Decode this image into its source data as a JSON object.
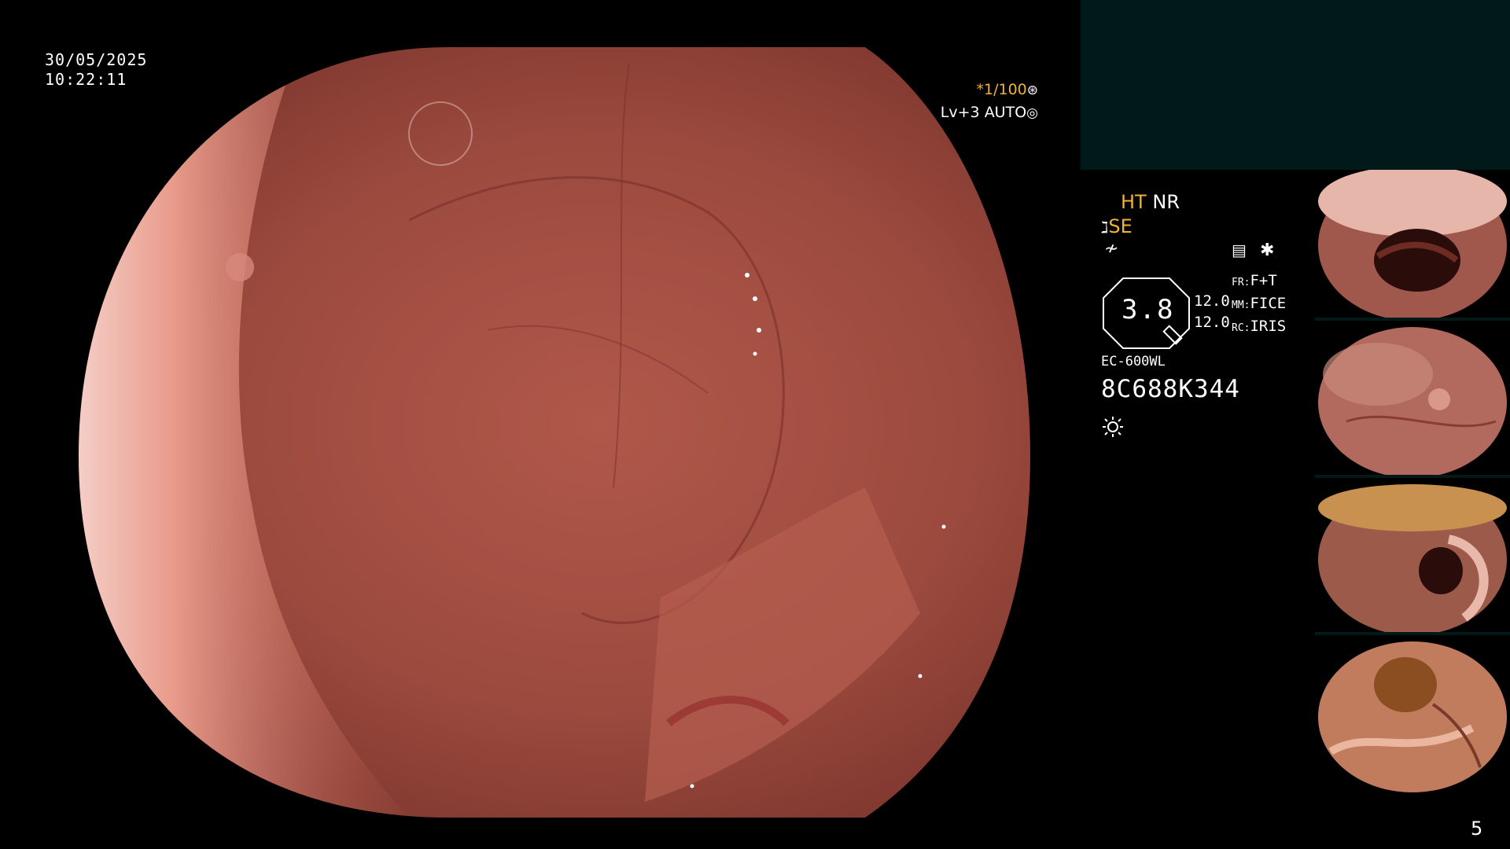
{
  "datetime": {
    "date": "30/05/2025",
    "time": "10:22:11"
  },
  "shutter": {
    "speed": "*1/100",
    "level": "Lv+3",
    "mode": "AUTO"
  },
  "enhancement": {
    "ht": "HT",
    "nr": "NR",
    "se": "SE"
  },
  "zoom": {
    "value": "3.8"
  },
  "settings": {
    "value_a": "12.0",
    "value_b": "12.0",
    "fr_label": "FR:",
    "fr_value": "F+T",
    "mm_label": "MM:",
    "mm_value": "FICE",
    "rc_label": "RC:",
    "rc_value": "IRIS"
  },
  "scope": {
    "model": "EC-600WL",
    "serial": "8C688K344"
  },
  "page": {
    "number": "5"
  },
  "colors": {
    "accent": "#f2b233",
    "panel": "#02191a"
  },
  "icons": {
    "shutter": "aperture-icon",
    "auto": "target-icon",
    "light": "sun-icon",
    "memo": "document-icon"
  }
}
